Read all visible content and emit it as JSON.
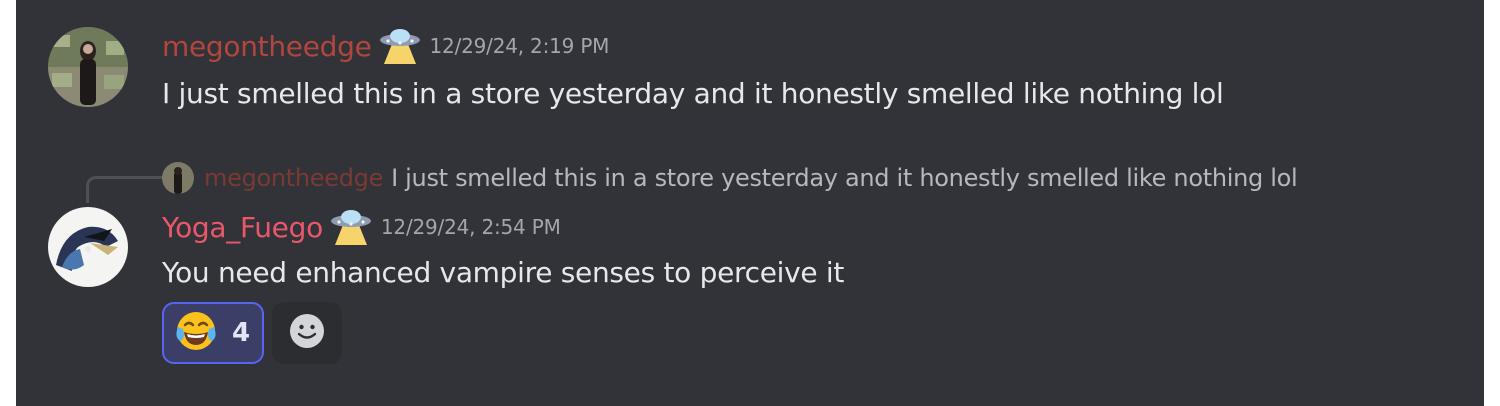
{
  "messages": [
    {
      "author": "megontheedge",
      "author_color": "#b0463d",
      "badge_icon": "ufo-icon",
      "timestamp": "12/29/24, 2:19 PM",
      "text": "I just smelled this in a store yesterday and it honestly smelled like nothing lol"
    },
    {
      "reply_to": {
        "author": "megontheedge",
        "text": "I just smelled this in a store yesterday and it honestly smelled like nothing lol"
      },
      "author": "Yoga_Fuego",
      "author_color": "#e8576a",
      "badge_icon": "ufo-icon",
      "timestamp": "12/29/24, 2:54 PM",
      "text": "You need enhanced vampire senses to perceive it",
      "reactions": [
        {
          "emoji": "face-with-tears-of-joy-icon",
          "count": "4",
          "active": true
        }
      ],
      "add_reaction_icon": "add-reaction-smiley-icon"
    }
  ],
  "colors": {
    "background": "#313338",
    "reaction_active_bg": "#3b3e67",
    "reaction_active_border": "#5865f2"
  }
}
